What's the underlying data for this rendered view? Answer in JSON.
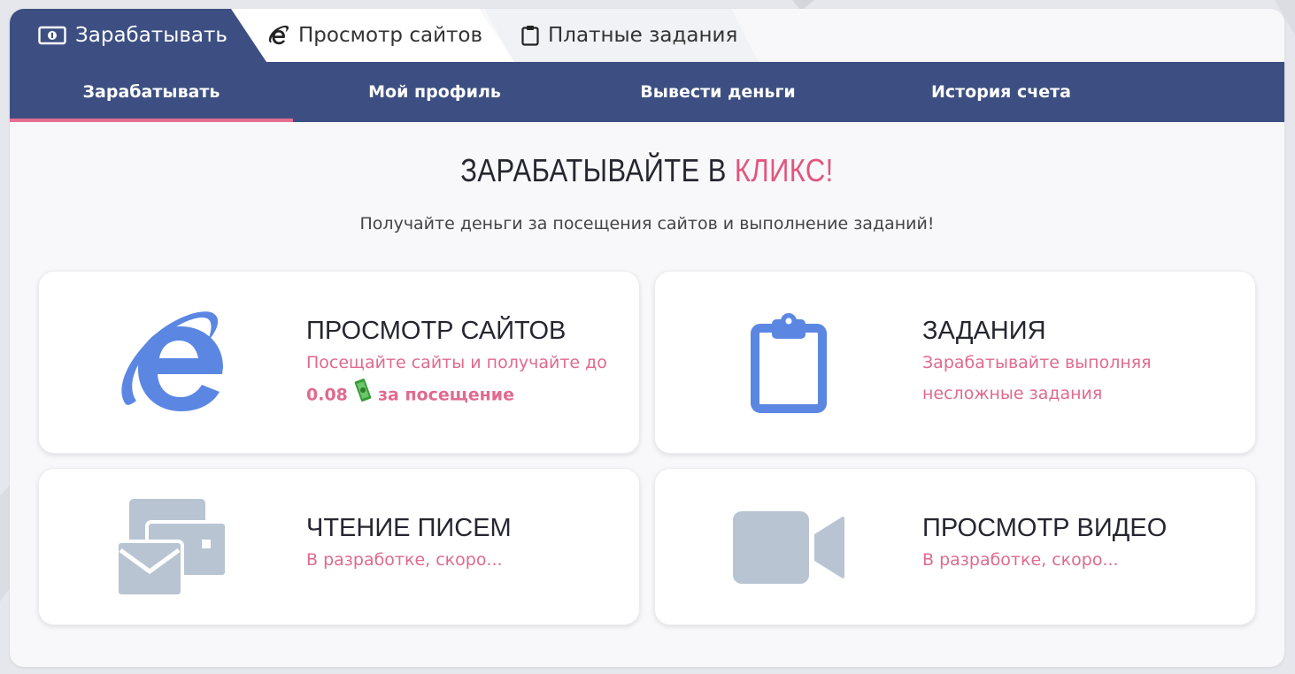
{
  "top_tabs": [
    {
      "label": "Зарабатывать",
      "icon": "money-icon",
      "active": true
    },
    {
      "label": "Просмотр сайтов",
      "icon": "internet-explorer-icon",
      "active": false
    },
    {
      "label": "Платные задания",
      "icon": "clipboard-icon",
      "active": false
    }
  ],
  "subnav": [
    {
      "label": "Зарабатывать",
      "active": true
    },
    {
      "label": "Мой профиль",
      "active": false
    },
    {
      "label": "Вывести деньги",
      "active": false
    },
    {
      "label": "История счета",
      "active": false
    }
  ],
  "headline": {
    "text": "ЗАРАБАТЫВАЙТЕ В ",
    "accent": "КЛИКС!"
  },
  "subtitle": "Получайте деньги за посещения сайтов и выполнение заданий!",
  "cards": [
    {
      "title": "ПРОСМОТР САЙТОВ",
      "desc_line1": "Посещайте сайты и получайте до",
      "amount": "0.08",
      "desc_tail": "за посещение",
      "icon": "internet-explorer-icon"
    },
    {
      "title": "ЗАДАНИЯ",
      "desc_line1": "Зарабатывайте выполняя",
      "desc_line2": "несложные задания",
      "icon": "clipboard-icon"
    },
    {
      "title": "ЧТЕНИЕ ПИСЕМ",
      "desc_line1": "В разработке, скоро...",
      "icon": "envelopes-icon"
    },
    {
      "title": "ПРОСМОТР ВИДЕО",
      "desc_line1": "В разработке, скоро...",
      "icon": "video-camera-icon"
    }
  ],
  "colors": {
    "nav_bg": "#3d4f82",
    "accent_pink": "#e2557e",
    "icon_blue": "#5b87e3",
    "icon_gray": "#b8c4d2"
  }
}
